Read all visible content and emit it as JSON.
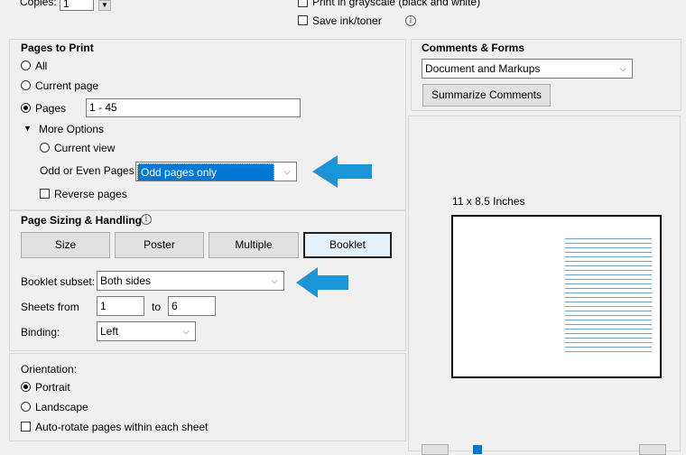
{
  "top": {
    "copies_label": "Copies:",
    "copies_value": "1",
    "grayscale_label": "Print in grayscale (black and white)",
    "save_ink_label": "Save ink/toner"
  },
  "pages_to_print": {
    "title": "Pages to Print",
    "all_label": "All",
    "current_page_label": "Current page",
    "pages_label": "Pages",
    "pages_value": "1 - 45",
    "more_options_label": "More Options",
    "current_view_label": "Current view",
    "odd_even_label": "Odd or Even Pages:",
    "odd_even_value": "Odd pages only",
    "reverse_label": "Reverse pages"
  },
  "sizing": {
    "title": "Page Sizing & Handling",
    "tabs": [
      "Size",
      "Poster",
      "Multiple",
      "Booklet"
    ],
    "booklet_subset_label": "Booklet subset:",
    "booklet_subset_value": "Both sides",
    "sheets_from_label": "Sheets from",
    "sheets_from_value": "1",
    "to_label": "to",
    "sheets_to_value": "6",
    "binding_label": "Binding:",
    "binding_value": "Left"
  },
  "orientation": {
    "title": "Orientation:",
    "portrait_label": "Portrait",
    "landscape_label": "Landscape",
    "autorotate_label": "Auto-rotate pages within each sheet"
  },
  "comments_forms": {
    "title": "Comments & Forms",
    "value": "Document and Markups",
    "summarize_label": "Summarize Comments"
  },
  "preview": {
    "size_label": "11 x 8.5 Inches"
  },
  "colors": {
    "accent_arrow": "#1a96d8",
    "selected_highlight": "#0078d7"
  }
}
